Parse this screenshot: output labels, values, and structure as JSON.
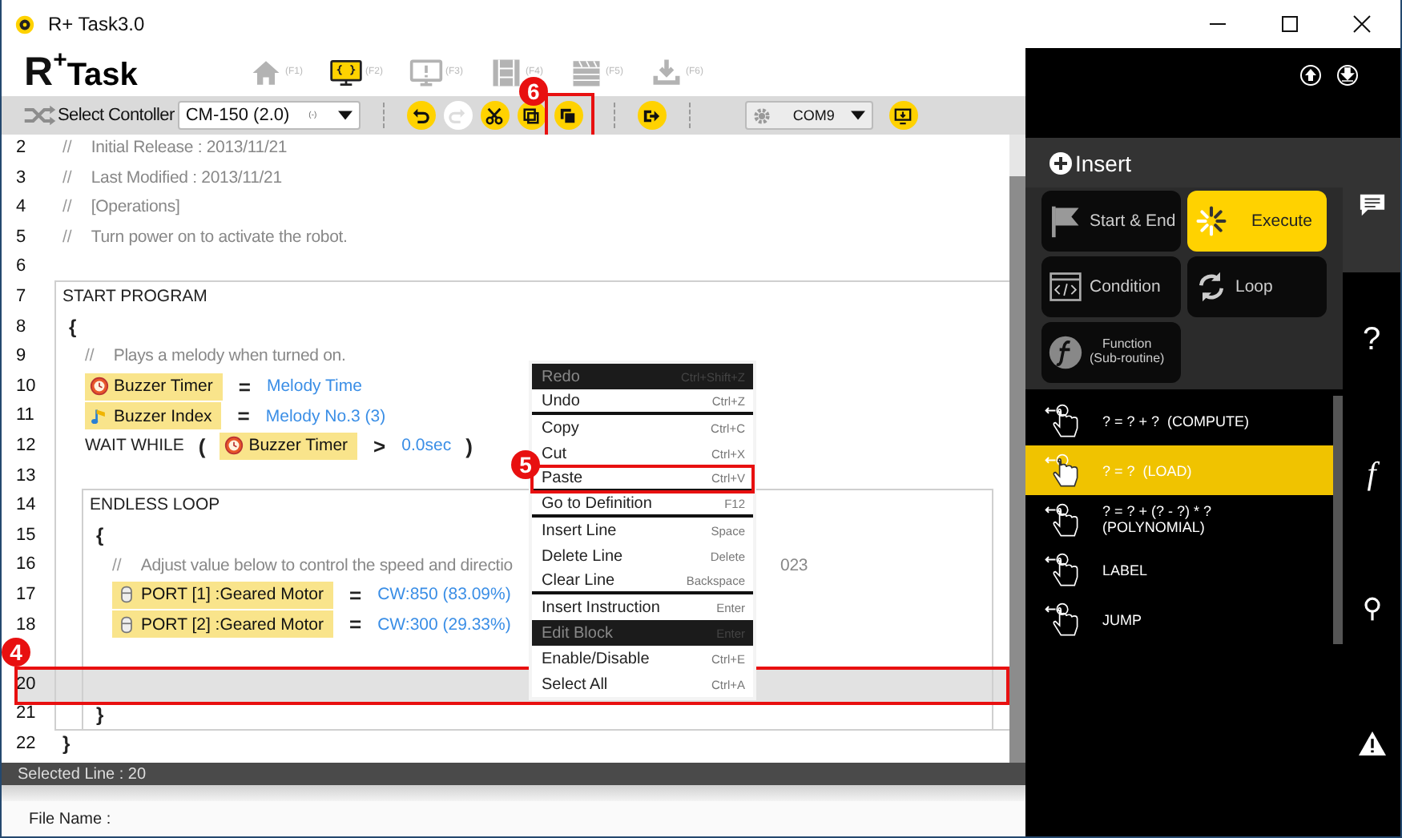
{
  "window": {
    "title": "R+ Task3.0"
  },
  "logo": {
    "letter": "R",
    "plus": "+",
    "word": "Task"
  },
  "nav_tabs": [
    {
      "kind": "home",
      "label": "(F1)",
      "selected": false
    },
    {
      "kind": "code",
      "label": "(F2)",
      "selected": true
    },
    {
      "kind": "alert",
      "label": "(F3)",
      "selected": false
    },
    {
      "kind": "film",
      "label": "(F4)",
      "selected": false
    },
    {
      "kind": "clapper",
      "label": "(F5)",
      "selected": false
    },
    {
      "kind": "download",
      "label": "(F6)",
      "selected": false
    }
  ],
  "toolbar": {
    "controller_label": "Select Contoller",
    "controller": {
      "value": "CM-150 (2.0)",
      "hint": "(-)"
    },
    "edit_buttons": [
      {
        "kind": "undo",
        "disabled": false
      },
      {
        "kind": "redo",
        "disabled": true
      },
      {
        "kind": "cut",
        "disabled": false
      },
      {
        "kind": "copy",
        "disabled": false
      },
      {
        "kind": "paste",
        "disabled": false,
        "annotation": "6"
      }
    ],
    "port": "COM9"
  },
  "code": {
    "lines": [
      {
        "number": "2",
        "kind": "comment",
        "mark": "//",
        "text": "Initial Release : 2013/11/21",
        "selected": false
      },
      {
        "number": "3",
        "kind": "comment",
        "mark": "//",
        "text": "Last Modified : 2013/11/21",
        "selected": false
      },
      {
        "number": "4",
        "kind": "comment",
        "mark": "//",
        "text": "[Operations]",
        "selected": false
      },
      {
        "number": "5",
        "kind": "comment",
        "mark": "//",
        "text": "Turn power on to activate the robot.",
        "selected": false
      },
      {
        "number": "6",
        "kind": "blank",
        "selected": false
      },
      {
        "number": "7",
        "kind": "block",
        "title": "START PROGRAM",
        "selected": false,
        "children": [
          {
            "number": "8",
            "kind": "brace",
            "text": "{",
            "selected": false
          },
          {
            "number": "9",
            "kind": "comment",
            "mark": "//",
            "text": "Plays a melody when turned on.",
            "selected": false
          },
          {
            "number": "10",
            "kind": "assign",
            "target": {
              "kind": "timer",
              "text": "Buzzer Timer"
            },
            "op": "=",
            "value": "Melody Time",
            "selected": false
          },
          {
            "number": "11",
            "kind": "assign",
            "target": {
              "kind": "note",
              "text": "Buzzer Index"
            },
            "op": "=",
            "value": "Melody No.3 (3)",
            "selected": false
          },
          {
            "number": "12",
            "kind": "wait",
            "keyword": "WAIT WHILE",
            "open": "(",
            "target": {
              "kind": "timer",
              "text": "Buzzer Timer"
            },
            "op": ">",
            "value": "0.0sec",
            "close": ")",
            "selected": false
          },
          {
            "number": "13",
            "kind": "blank",
            "selected": false
          },
          {
            "number": "14",
            "kind": "block",
            "title": "ENDLESS LOOP",
            "selected": false,
            "children": [
              {
                "number": "15",
                "kind": "brace",
                "text": "{",
                "selected": false
              },
              {
                "number": "16",
                "kind": "comment",
                "mark": "//",
                "text": "Adjust value below to control the speed and directio",
                "tail": "023",
                "selected": false
              },
              {
                "number": "17",
                "kind": "assign",
                "target": {
                  "kind": "motor",
                  "text": "PORT [1] :Geared Motor"
                },
                "op": "=",
                "value": "CW:850 (83.09%)",
                "selected": false
              },
              {
                "number": "18",
                "kind": "assign",
                "target": {
                  "kind": "motor",
                  "text": "PORT [2] :Geared Motor"
                },
                "op": "=",
                "value": "CW:300 (29.33%)",
                "selected": false
              },
              {
                "kind": "blank",
                "selected": false
              },
              {
                "number": "20",
                "kind": "blank",
                "selected": true,
                "annotation": "4"
              },
              {
                "number": "21",
                "kind": "brace",
                "text": "}",
                "selected": false
              }
            ]
          }
        ]
      },
      {
        "number": "22",
        "kind": "brace",
        "text": "}",
        "selected": false
      }
    ]
  },
  "context_menu": [
    {
      "label": "Redo",
      "shortcut": "Ctrl+Shift+Z",
      "disabled": true,
      "separator": false
    },
    {
      "label": "Undo",
      "shortcut": "Ctrl+Z",
      "disabled": false,
      "separator": true
    },
    {
      "label": "Copy",
      "shortcut": "Ctrl+C",
      "disabled": false,
      "separator": false
    },
    {
      "label": "Cut",
      "shortcut": "Ctrl+X",
      "disabled": false,
      "separator": false
    },
    {
      "label": "Paste",
      "shortcut": "Ctrl+V",
      "disabled": false,
      "separator": true,
      "annotation": "5"
    },
    {
      "label": "Go to Definition",
      "shortcut": "F12",
      "disabled": false,
      "separator": true
    },
    {
      "label": "Insert Line",
      "shortcut": "Space",
      "disabled": false,
      "separator": false
    },
    {
      "label": "Delete Line",
      "shortcut": "Delete",
      "disabled": false,
      "separator": false
    },
    {
      "label": "Clear Line",
      "shortcut": "Backspace",
      "disabled": false,
      "separator": true
    },
    {
      "label": "Insert Instruction",
      "shortcut": "Enter",
      "disabled": false,
      "separator": false
    },
    {
      "label": "Edit Block",
      "shortcut": "Enter",
      "disabled": true,
      "separator": false
    },
    {
      "label": "Enable/Disable",
      "shortcut": "Ctrl+E",
      "disabled": false,
      "separator": false
    },
    {
      "label": "Select All",
      "shortcut": "Ctrl+A",
      "disabled": false,
      "separator": false
    }
  ],
  "status_bar": {
    "selected_line": "Selected Line : 20",
    "file_name": "File Name :"
  },
  "insert_panel": {
    "title": "Insert",
    "categories": [
      {
        "kind": "flag",
        "label": "Start & End",
        "selected": false
      },
      {
        "kind": "spinner",
        "label": "Execute",
        "selected": true
      },
      {
        "kind": "code",
        "label": "Condition",
        "selected": false
      },
      {
        "kind": "loop",
        "label": "Loop",
        "selected": false
      },
      {
        "kind": "function",
        "label": "Function",
        "sublabel": "(Sub-routine)",
        "selected": false
      }
    ],
    "instructions": [
      {
        "label": "? = ? + ?  (COMPUTE)",
        "selected": false
      },
      {
        "label": "? = ?  (LOAD)",
        "selected": true
      },
      {
        "label": "? = ? + (? - ?) * ?",
        "sublabel": "(POLYNOMIAL)",
        "selected": false
      },
      {
        "label": "LABEL",
        "selected": false
      },
      {
        "label": "JUMP",
        "selected": false
      }
    ]
  },
  "side_tabs": [
    {
      "kind": "chat",
      "selected": true
    },
    {
      "kind": "text",
      "label": "?",
      "selected": false
    },
    {
      "kind": "italic",
      "label": "f",
      "selected": false
    },
    {
      "kind": "pin",
      "selected": false
    },
    {
      "kind": "warning",
      "selected": false
    }
  ]
}
